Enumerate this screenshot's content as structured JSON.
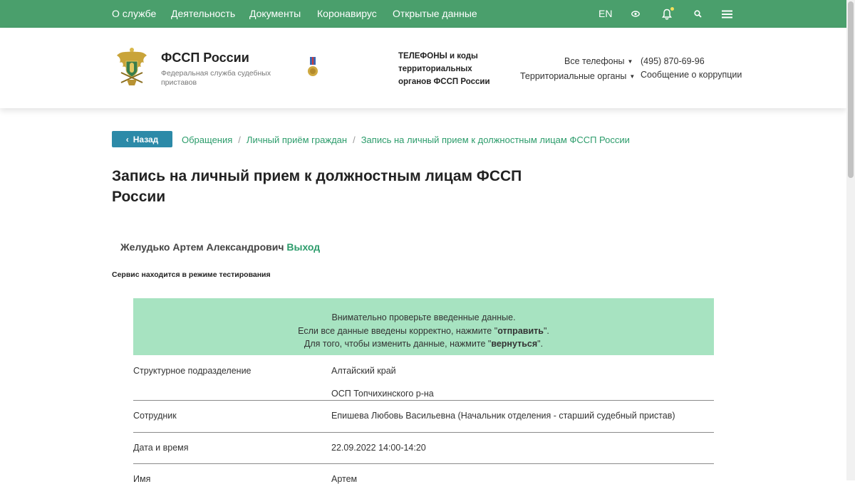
{
  "topnav": {
    "links": [
      "О службе",
      "Деятельность",
      "Документы",
      "Коронавирус",
      "Открытые данные"
    ],
    "lang": "EN",
    "icons": [
      "eye-icon",
      "bell-icon",
      "search-icon",
      "menu-icon"
    ]
  },
  "header": {
    "brand_title": "ФССП России",
    "brand_subtitle": "Федеральная служба судебных приставов",
    "phones_title": "ТЕЛЕФОНЫ и коды территориальных органов ФССП России",
    "all_phones": "Все телефоны",
    "territorial": "Территориальные органы",
    "phone": "(495) 870-69-96",
    "corruption": "Сообщение о коррупции"
  },
  "back_label": "Назад",
  "breadcrumbs": [
    "Обращения",
    "Личный приём граждан",
    "Запись на личный прием к должностным лицам ФССП России"
  ],
  "page_title": "Запись на личный прием к должностным лицам ФССП России",
  "user": {
    "name": "Желудько Артем Александрович",
    "logout": "Выход"
  },
  "test_note": "Сервис находится в режиме тестирования",
  "notice": {
    "line1": "Внимательно проверьте введенные данные.",
    "line2_pre": "Если все данные введены корректно, нажмите \"",
    "line2_bold": "отправить",
    "line2_post": "\".",
    "line3_pre": "Для того, чтобы изменить данные, нажмите \"",
    "line3_bold": "вернуться",
    "line3_post": "\"."
  },
  "rows": {
    "division_label": "Структурное подразделение",
    "division_value_1": "Алтайский край",
    "division_value_2": "ОСП Топчихинского р-на",
    "employee_label": "Сотрудник",
    "employee_value": "Епишева Любовь Васильевна (Начальник отделения - старший судебный пристав)",
    "datetime_label": "Дата и время",
    "datetime_value": "22.09.2022 14:00-14:20",
    "name_label": "Имя",
    "name_value": "Артем"
  },
  "colors": {
    "nav_green": "#4a9f6c",
    "link_green": "#2c9c6b",
    "notice_bg": "#a7e3c1",
    "back_btn": "#2c8aa8"
  }
}
